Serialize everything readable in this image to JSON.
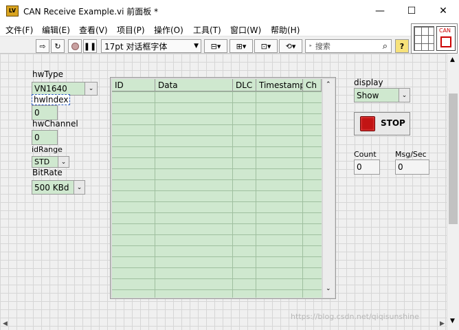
{
  "window": {
    "title": "CAN Receive Example.vi 前面板 *",
    "minimize": "—",
    "maximize": "☐",
    "close": "✕",
    "app_icon": "LV"
  },
  "menu": [
    "文件(F)",
    "编辑(E)",
    "查看(V)",
    "项目(P)",
    "操作(O)",
    "工具(T)",
    "窗口(W)",
    "帮助(H)"
  ],
  "toolbar": {
    "font_select": "17pt 对话框字体",
    "search_placeholder": "搜索",
    "help_glyph": "?"
  },
  "connector": {
    "label": "CAN"
  },
  "controls": {
    "hwType": {
      "label": "hwType",
      "value": "VN1640"
    },
    "hwIndex": {
      "label": "hwIndex",
      "value": "0"
    },
    "hwChannel": {
      "label": "hwChannel",
      "value": "0"
    },
    "idRange": {
      "label": "idRange",
      "value": "STD"
    },
    "bitRate": {
      "label": "BitRate",
      "value": "500 KBd"
    },
    "display": {
      "label": "display",
      "value": "Show"
    },
    "stop": {
      "label": "STOP"
    }
  },
  "indicators": {
    "count": {
      "label": "Count",
      "value": "0"
    },
    "msg_sec": {
      "label": "Msg/Sec",
      "value": "0"
    }
  },
  "table": {
    "columns": [
      "ID",
      "Data",
      "DLC",
      "Timestamp",
      "Ch"
    ]
  },
  "watermark": "https://blog.csdn.net/qiqisunshine"
}
